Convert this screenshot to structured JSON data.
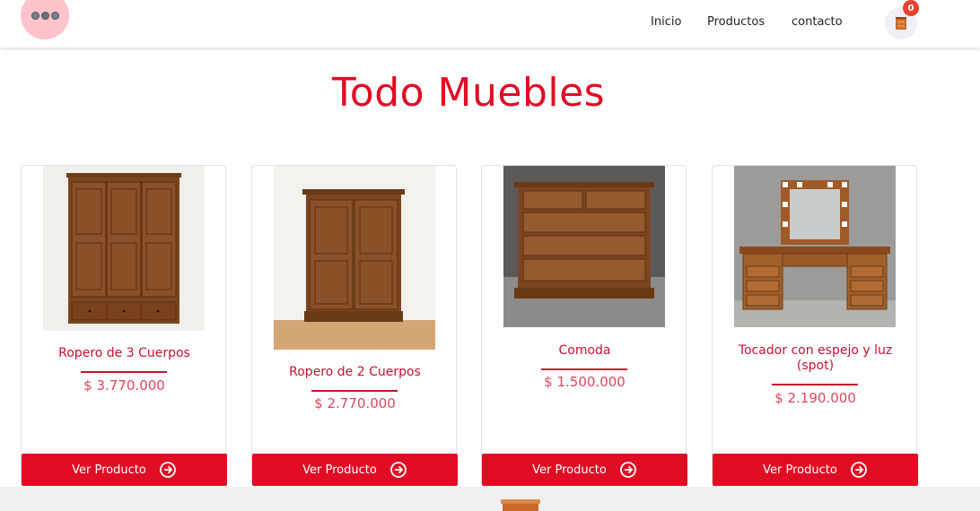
{
  "header": {
    "nav": [
      {
        "label": "Inicio"
      },
      {
        "label": "Productos"
      },
      {
        "label": "contacto"
      }
    ],
    "cart": {
      "count": "0",
      "icon": "cart-icon"
    }
  },
  "main": {
    "title": "Todo Muebles"
  },
  "products": [
    {
      "name": "Ropero de 3 Cuerpos",
      "price": "$ 3.770.000",
      "button": "Ver Producto",
      "image": "wardrobe-3-doors"
    },
    {
      "name": "Ropero de 2 Cuerpos",
      "price": "$ 2.770.000",
      "button": "Ver Producto",
      "image": "wardrobe-2-doors"
    },
    {
      "name": "Comoda",
      "price": "$ 1.500.000",
      "button": "Ver Producto",
      "image": "chest-of-drawers"
    },
    {
      "name": "Tocador con espejo y luz (spot)",
      "price": "$ 2.190.000",
      "button": "Ver Producto",
      "image": "vanity-with-lights"
    }
  ],
  "colors": {
    "accent": "#e00c24",
    "price": "#d9475b",
    "badge": "#e8412f",
    "logo_bg": "#ffc3cb"
  }
}
